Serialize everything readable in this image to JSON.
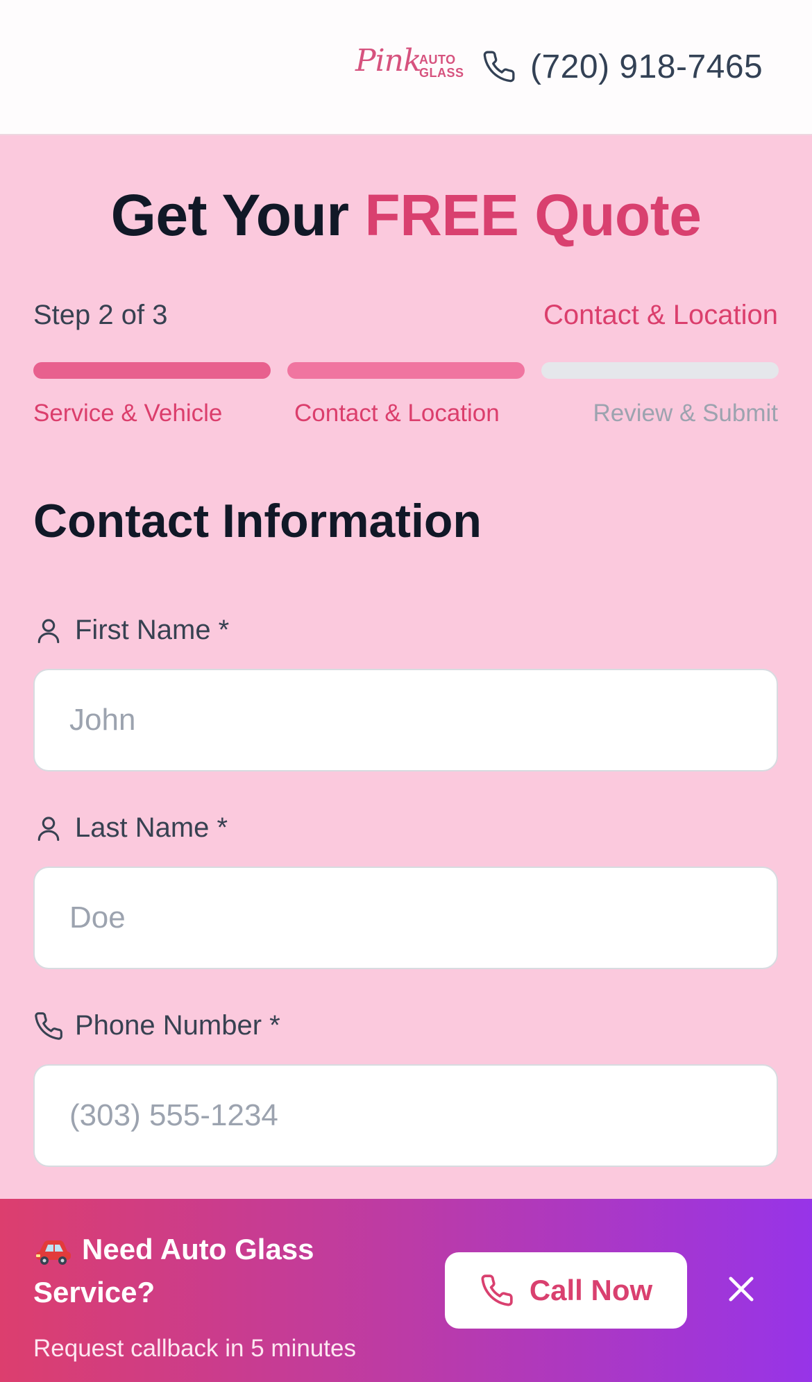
{
  "header": {
    "logo": {
      "script": "Pink",
      "line1": "AUTO",
      "line2": "GLASS"
    },
    "phone": "(720) 918-7465"
  },
  "hero": {
    "title_part1": "Get Your",
    "title_part2": "FREE Quote"
  },
  "progress": {
    "step_text": "Step 2 of 3",
    "current_step_name": "Contact & Location",
    "current_step": 2,
    "total_steps": 3,
    "steps": [
      {
        "label": "Service & Vehicle",
        "state": "complete"
      },
      {
        "label": "Contact & Location",
        "state": "active"
      },
      {
        "label": "Review & Submit",
        "state": "pending"
      }
    ]
  },
  "form": {
    "section_title": "Contact Information",
    "fields": [
      {
        "label": "First Name *",
        "placeholder": "John",
        "value": "",
        "icon": "user-icon"
      },
      {
        "label": "Last Name *",
        "placeholder": "Doe",
        "value": "",
        "icon": "user-icon"
      },
      {
        "label": "Phone Number *",
        "placeholder": "(303) 555-1234",
        "value": "",
        "icon": "phone-icon"
      }
    ]
  },
  "banner": {
    "title": "Need Auto Glass Service?",
    "subtitle": "Request callback in 5 minutes",
    "button_label": "Call Now",
    "icons": [
      "car-icon",
      "phone-icon",
      "close-icon"
    ]
  },
  "colors": {
    "brand_pink": "#d9406f",
    "page_background": "#fbc9dd",
    "gradient_start": "#dc3e6e",
    "gradient_end": "#9734e8"
  }
}
